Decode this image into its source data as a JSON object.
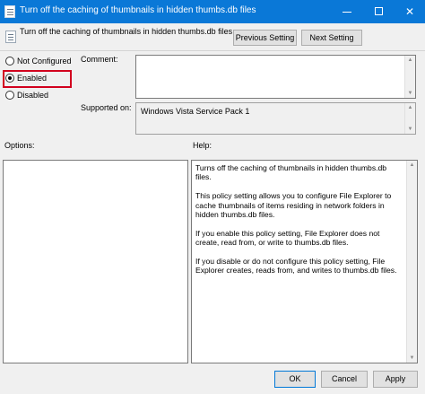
{
  "window": {
    "title": "Turn off the caching of thumbnails in hidden thumbs.db files",
    "minimize_glyph": "",
    "close_glyph": "✕"
  },
  "header": {
    "title": "Turn off the caching of thumbnails in hidden thumbs.db files",
    "previous_label": "Previous Setting",
    "next_label": "Next Setting"
  },
  "state": {
    "options": [
      {
        "label": "Not Configured",
        "checked": false
      },
      {
        "label": "Enabled",
        "checked": true
      },
      {
        "label": "Disabled",
        "checked": false
      }
    ],
    "highlight_color": "#d2001e"
  },
  "comment": {
    "label": "Comment:",
    "value": ""
  },
  "supported": {
    "label": "Supported on:",
    "value": "Windows Vista Service Pack 1"
  },
  "options_pane": {
    "label": "Options:"
  },
  "help_pane": {
    "label": "Help:",
    "paragraphs": [
      "Turns off the caching of thumbnails in hidden thumbs.db files.",
      "This policy setting allows you to configure File Explorer to cache thumbnails of items residing in network folders in hidden thumbs.db files.",
      "If you enable this policy setting, File Explorer does not create, read from, or write to thumbs.db files.",
      "If you disable or do not configure this policy setting, File Explorer creates, reads from, and writes to thumbs.db files."
    ]
  },
  "footer": {
    "ok_label": "OK",
    "cancel_label": "Cancel",
    "apply_label": "Apply"
  },
  "colors": {
    "titlebar": "#0a78d7",
    "accent_border": "#0078d7"
  }
}
